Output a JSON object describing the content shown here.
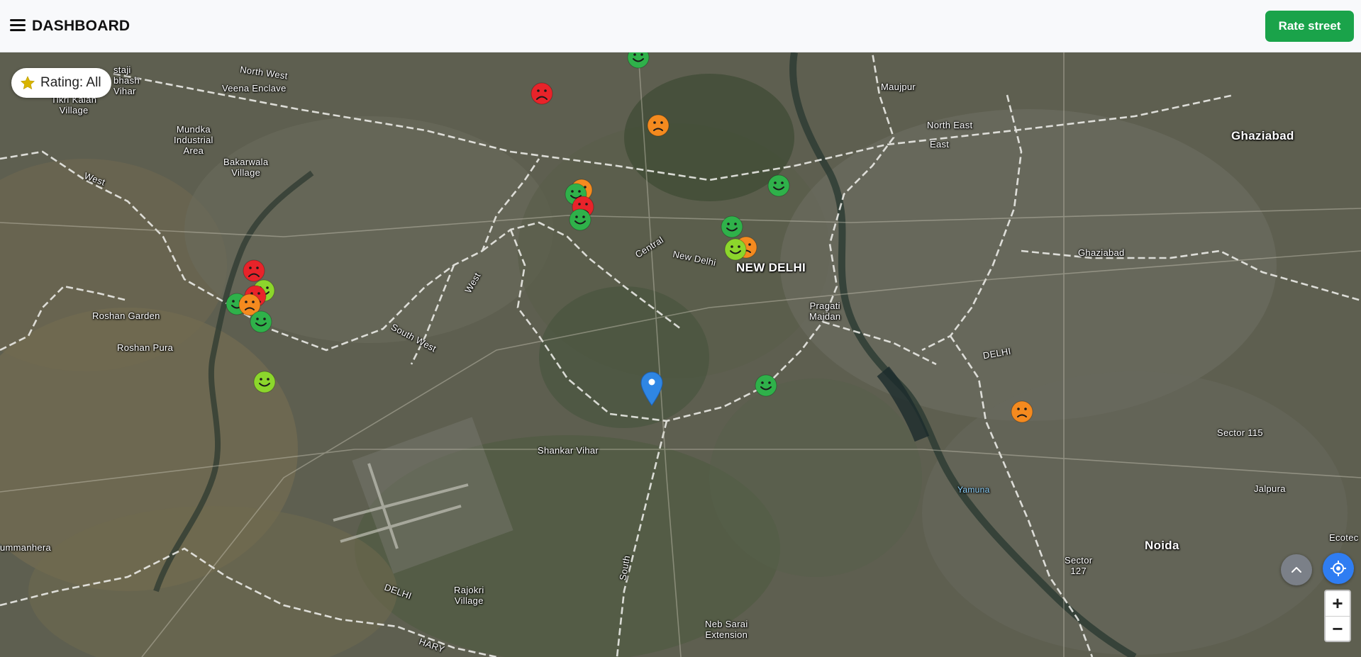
{
  "header": {
    "menu_icon": "hamburger-menu-icon",
    "title": "DASHBOARD",
    "rate_button": "Rate street"
  },
  "filter": {
    "icon": "star-icon",
    "label": "Rating: All"
  },
  "colors": {
    "primary_green": "#1aa34a",
    "rating_good": "#2fb14a",
    "rating_ok": "#8cd62c",
    "rating_fair": "#f48a1f",
    "rating_bad": "#e8232a",
    "locate_button": "#2f7df2",
    "pin": "#2f86e4"
  },
  "map": {
    "labels": [
      "North West",
      "Veena Enclave",
      "Tikri Kalan\nVillage",
      "Mundka\nIndustrial\nArea",
      "Bakarwala\nVillage",
      "West",
      "Roshan Garden",
      "Roshan Pura",
      "South West",
      "Central",
      "New Delhi",
      "West",
      "NEW DELHI",
      "Pragati\nMaidan",
      "Maujpur",
      "North East",
      "East",
      "Ghaziabad",
      "Ghaziabad",
      "DELHI",
      "Sector 115",
      "Jalpura",
      "Yamuna",
      "Noida",
      "Sector\n127",
      "Shankar Vihar",
      "South",
      "Rajokri\nVillage",
      "DELHI",
      "Neb Sarai\nExtension",
      "ummanhera",
      "staji\nbhash\nVihar",
      "Ecotec",
      "HARY"
    ],
    "markers": [
      {
        "rating": "good"
      },
      {
        "rating": "bad"
      },
      {
        "rating": "fair"
      },
      {
        "rating": "good"
      },
      {
        "rating": "fair"
      },
      {
        "rating": "good"
      },
      {
        "rating": "bad"
      },
      {
        "rating": "good"
      },
      {
        "rating": "good"
      },
      {
        "rating": "fair"
      },
      {
        "rating": "ok"
      },
      {
        "rating": "bad"
      },
      {
        "rating": "ok"
      },
      {
        "rating": "bad"
      },
      {
        "rating": "good"
      },
      {
        "rating": "fair"
      },
      {
        "rating": "good"
      },
      {
        "rating": "ok"
      },
      {
        "rating": "good"
      },
      {
        "rating": "fair"
      }
    ]
  },
  "controls": {
    "scroll_up_icon": "chevron-up-icon",
    "locate_icon": "crosshair-locate-icon",
    "zoom_in": "+",
    "zoom_out": "−"
  }
}
